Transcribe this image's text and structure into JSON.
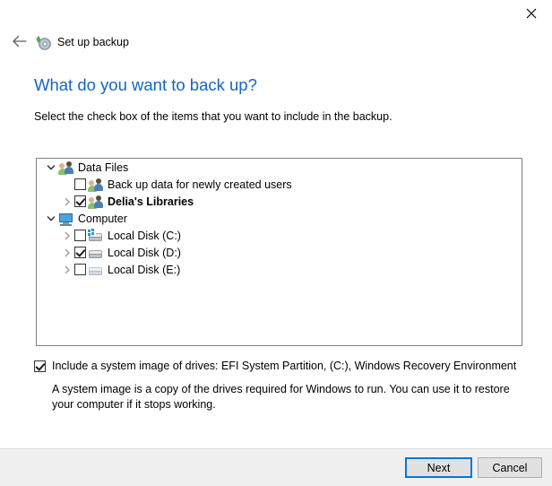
{
  "window": {
    "close_label": "×",
    "back_label": "←",
    "app_icon": "backup-disc-icon",
    "app_title": "Set up backup"
  },
  "page": {
    "title": "What do you want to back up?",
    "subtitle": "Select the check box of the items that you want to include in the backup.",
    "title_color": "#1565C0"
  },
  "tree": {
    "nodes": [
      {
        "label": "Data Files",
        "level": 0,
        "expander": "chevron-down",
        "has_checkbox": false,
        "checked": false,
        "icon": "people-icon",
        "bold": false
      },
      {
        "label": "Back up data for newly created users",
        "level": 1,
        "expander": "none",
        "has_checkbox": true,
        "checked": false,
        "icon": "people-icon",
        "bold": false
      },
      {
        "label": "Delia's Libraries",
        "level": 1,
        "expander": "chevron-right",
        "has_checkbox": true,
        "checked": true,
        "icon": "people-icon",
        "bold": true
      },
      {
        "label": "Computer",
        "level": 0,
        "expander": "chevron-down",
        "has_checkbox": false,
        "checked": false,
        "icon": "monitor-icon",
        "bold": false
      },
      {
        "label": "Local Disk (C:)",
        "level": 1,
        "expander": "chevron-right",
        "has_checkbox": true,
        "checked": false,
        "icon": "windows-drive-icon",
        "bold": false
      },
      {
        "label": "Local Disk (D:)",
        "level": 1,
        "expander": "chevron-right",
        "has_checkbox": true,
        "checked": true,
        "icon": "drive-icon",
        "bold": false
      },
      {
        "label": "Local Disk (E:)",
        "level": 1,
        "expander": "chevron-right",
        "has_checkbox": true,
        "checked": false,
        "icon": "drive-dim-icon",
        "bold": false
      }
    ]
  },
  "system_image": {
    "checked": true,
    "label": "Include a system image of drives: EFI System Partition, (C:), Windows Recovery Environment",
    "description": "A system image is a copy of the drives required for Windows to run. You can use it to restore your computer if it stops working."
  },
  "footer": {
    "next_label": "Next",
    "cancel_label": "Cancel",
    "focus_color": "#0078d7"
  }
}
